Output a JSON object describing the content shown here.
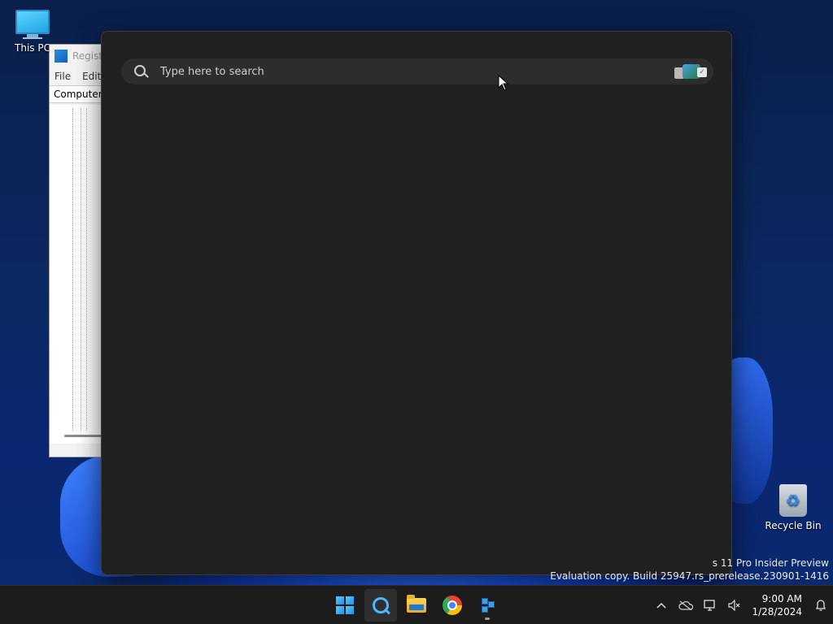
{
  "desktop": {
    "this_pc_label": "This PC",
    "recycle_bin_label": "Recycle Bin"
  },
  "regedit": {
    "title": "Registr",
    "menu": [
      "File",
      "Edit"
    ],
    "address": "Computer\\"
  },
  "search": {
    "placeholder": "Type here to search"
  },
  "watermark": {
    "line1": "s 11 Pro Insider Preview",
    "line2": "Evaluation copy. Build 25947.rs_prerelease.230901-1416"
  },
  "taskbar": {
    "apps": [
      {
        "name": "start",
        "icon": "windows-logo-icon"
      },
      {
        "name": "search",
        "icon": "search-icon",
        "active": true
      },
      {
        "name": "file-explorer",
        "icon": "folder-icon"
      },
      {
        "name": "chrome",
        "icon": "chrome-icon"
      },
      {
        "name": "registry-editor",
        "icon": "registry-icon",
        "running": true
      }
    ],
    "tray": {
      "icons": [
        "chevron-up-icon",
        "onedrive-offline-icon",
        "network-icon",
        "volume-muted-icon",
        "notification-icon"
      ],
      "time": "9:00 AM",
      "date": "1/28/2024"
    }
  },
  "colors": {
    "panel_bg": "#202020",
    "search_box_bg": "#2d2d2d",
    "taskbar_bg": "#1c1c1c",
    "accent": "#4db8ff"
  }
}
